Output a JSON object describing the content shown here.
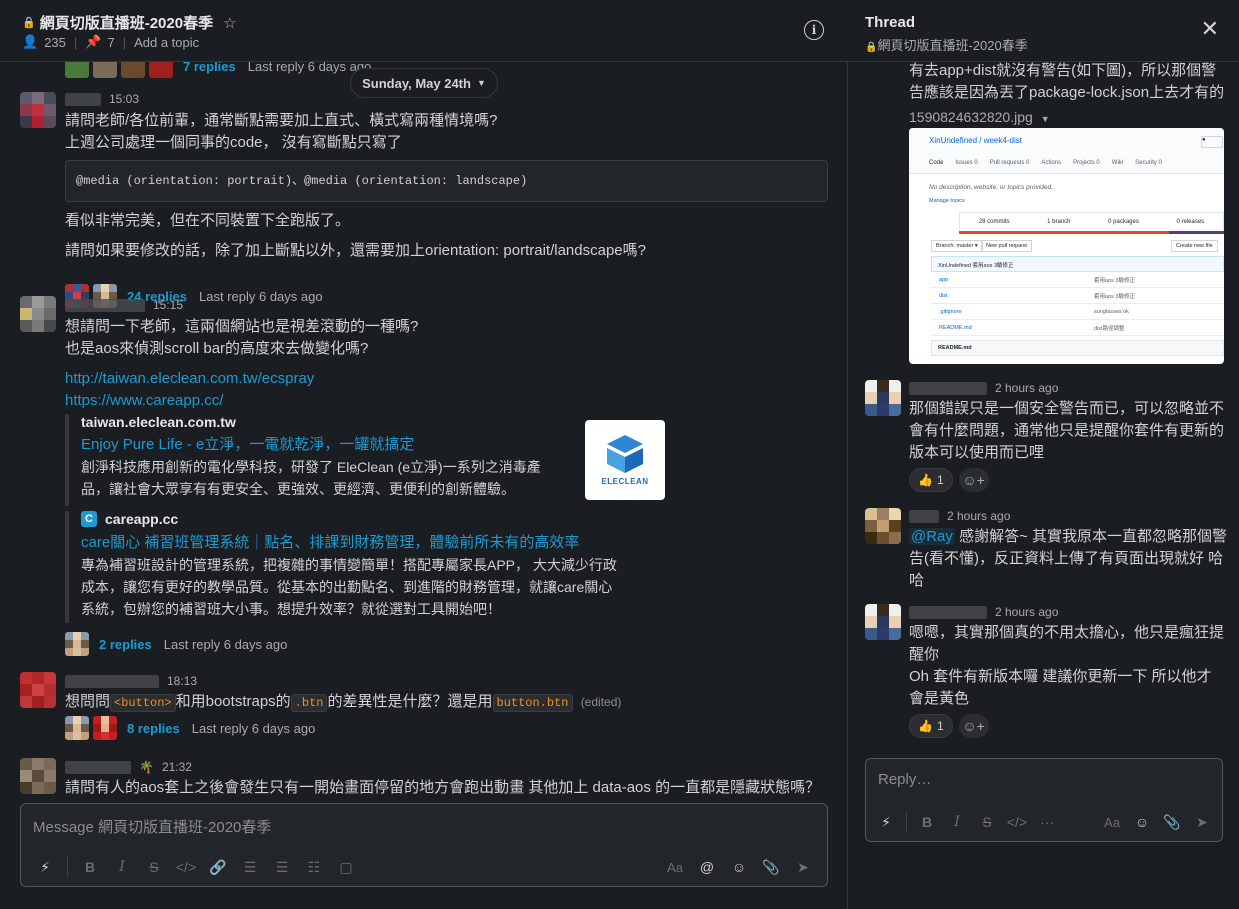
{
  "channel": {
    "name": "網頁切版直播班-2020春季",
    "members": "235",
    "pins": "7",
    "add_topic": "Add a topic",
    "info_icon": "info-icon"
  },
  "date_divider": "Sunday, May 24th",
  "top_replies": {
    "count": "7 replies",
    "last": "Last reply 6 days ago"
  },
  "messages": [
    {
      "time": "15:03",
      "line1": "請問老師/各位前輩，通常斷點需要加上直式、橫式寫兩種情境嗎?",
      "line2": "上週公司處理一個同事的code， 沒有寫斷點只寫了",
      "code": "@media (orientation: portrait)、@media (orientation: landscape)",
      "line3": "看似非常完美，但在不同裝置下全跑版了。",
      "line4": "請問如果要修改的話，除了加上斷點以外，還需要加上orientation: portrait/landscape嗎?",
      "replies": "24 replies",
      "last": "Last reply 6 days ago"
    },
    {
      "time": "15:15",
      "line1": "想請問一下老師，這兩個網站也是視差滾動的一種嗎?",
      "line2": "也是aos來偵測scroll bar的高度來去做變化嗎?",
      "link1": "http://taiwan.eleclean.com.tw/ecspray",
      "link2": "https://www.careapp.cc/",
      "unfurl1": {
        "site": "taiwan.eleclean.com.tw",
        "title": "Enjoy Pure Life - e立淨，一電就乾淨，一罐就搞定",
        "desc1": "創淨科技應用創新的電化學科技，研發了 EleClean (e立淨)一系列之消毒產",
        "desc2": "品，讓社會大眾享有有更安全、更強效、更經濟、更便利的創新體驗。",
        "thumb_label": "ELECLEAN"
      },
      "unfurl2": {
        "site": "careapp.cc",
        "title": "care關心 補習班管理系統｜點名、排課到財務管理，體驗前所未有的高效率",
        "desc1": "專為補習班設計的管理系統，把複雜的事情變簡單！搭配專屬家長APP， 大大減少行政",
        "desc2": "成本，讓您有更好的教學品質。從基本的出勤點名、到進階的財務管理，就讓care關心",
        "desc3": "系統，包辦您的補習班大小事。想提升效率？就從選對工具開始吧！"
      },
      "replies": "2 replies",
      "last": "Last reply 6 days ago"
    },
    {
      "time": "18:13",
      "pre": "想問問",
      "code1": "<button>",
      "mid": "和用bootstraps的",
      "code2": ".btn",
      "post": "的差異性是什麼？還是用",
      "code3": "button.btn",
      "edited": "(edited)",
      "replies": "8 replies",
      "last": "Last reply 6 days ago"
    },
    {
      "time": "21:32",
      "emoji": "🌴",
      "line1": "請問有人的aos套上之後會發生只有一開始畫面停留的地方會跑出動畫 其他加上 data-aos 的一直都是隱藏狀態嗎？"
    }
  ],
  "composer": {
    "placeholder": "Message 網頁切版直播班-2020春季"
  },
  "thread": {
    "title": "Thread",
    "subtitle": "網頁切版直播班-2020春季",
    "top_text1": "有去app+dist就沒有警告(如下圖)，所以那個警",
    "top_text2": "告應該是因為丟了package-lock.json上去才有的",
    "file_name": "1590824632820.jpg",
    "screenshot": {
      "repo": "XinUndefined / week4-dist",
      "tabs": [
        "Code",
        "Issues 0",
        "Pull requests 0",
        "Actions",
        "Projects 0",
        "Wiki",
        "Security 0"
      ],
      "desc": "No description, website, or topics provided.",
      "manage": "Manage topics",
      "stats": [
        "28 commits",
        "1 branch",
        "0 packages",
        "0 releases"
      ],
      "branch": "Branch: master ▾",
      "new_pr": "New pull request",
      "create": "Create new file",
      "commit": "XinUndefined 套用aos 3驗修正",
      "files": [
        {
          "name": "app",
          "msg": "套用aos 3驗修正"
        },
        {
          "name": "dist",
          "msg": "套用aos 3驗修正"
        },
        {
          "name": ".gitignore",
          "msg": "sunglasses ok"
        },
        {
          "name": "README.md",
          "msg": "dist路徑調整"
        }
      ],
      "readme": "README.md"
    },
    "replies": [
      {
        "time": "2 hours ago",
        "line1": "那個錯誤只是一個安全警告而已，可以忽略並不",
        "line2": "會有什麼問題，通常他只是提醒你套件有更新的",
        "line3": "版本可以使用而已哩",
        "react_emoji": "👍",
        "react_count": "1"
      },
      {
        "time": "2 hours ago",
        "mention": "@Ray",
        "line1": " 感謝解答~ 其實我原本一直都忽略那個警",
        "line2": "告(看不懂)，反正資料上傳了有頁面出現就好 哈",
        "line3": "哈"
      },
      {
        "time": "2 hours ago",
        "line1": "嗯嗯，其實那個真的不用太擔心，他只是瘋狂提",
        "line2": "醒你",
        "line3": "Oh 套件有新版本囉 建議你更新一下 所以他才",
        "line4": "會是黃色",
        "react_emoji": "👍",
        "react_count": "1"
      }
    ],
    "reply_placeholder": "Reply…"
  },
  "colors": {
    "bg": "#1a1d21",
    "link": "#1d9bd1",
    "code_orange": "#e8912d",
    "border": "#35373b"
  }
}
